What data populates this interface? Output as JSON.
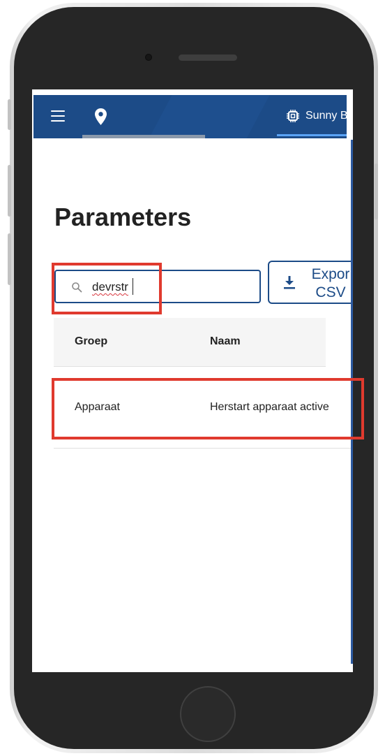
{
  "app_bar": {
    "device_name": "Sunny Bo"
  },
  "page": {
    "title": "Parameters"
  },
  "search": {
    "value": "devrstr"
  },
  "export": {
    "line1": "Expor",
    "line2": "CSV"
  },
  "table": {
    "columns": [
      "Groep",
      "Naam"
    ],
    "rows": [
      {
        "group": "Apparaat",
        "name": "Herstart apparaat active"
      }
    ]
  },
  "colors": {
    "primary": "#1c4b87",
    "accent_underline": "#5ba4f5",
    "annotation": "#e03a2e"
  },
  "icons": [
    "menu-icon",
    "location-pin-icon",
    "device-chip-icon",
    "search-icon",
    "download-icon"
  ]
}
